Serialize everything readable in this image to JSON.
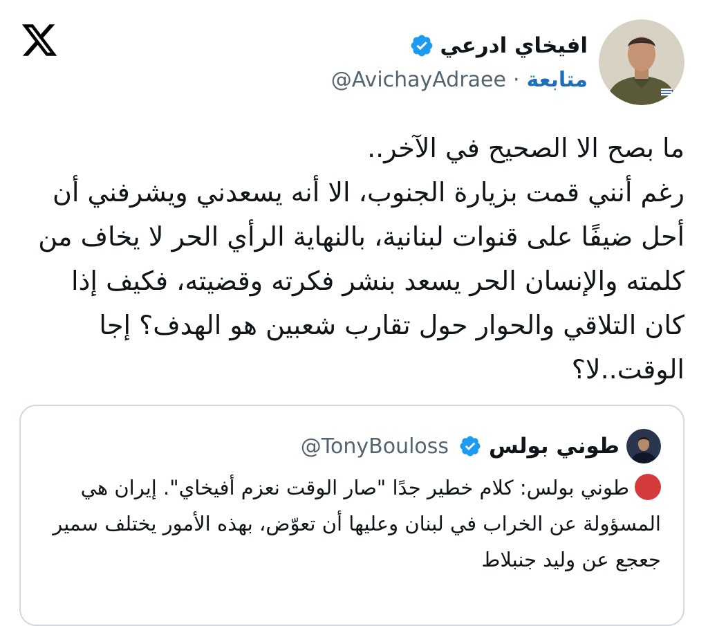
{
  "app": {
    "logo_icon": "x-logo-icon"
  },
  "tweet": {
    "author": {
      "display_name": "افيخاي ادرعي",
      "handle": "@AvichayAdraee",
      "verified_icon": "verified-badge-icon",
      "follow_label": "متابعة",
      "separator": "·"
    },
    "text": "ما بصح الا الصحيح في الآخر..\nرغم أنني قمت بزيارة الجنوب، الا أنه يسعدني ويشرفني أن أحل ضيفًا على قنوات لبنانية، بالنهاية الرأي الحر لا يخاف من كلمته والإنسان الحر يسعد بنشر فكرته وقضيته، فكيف إذا كان التلاقي والحوار حول تقارب شعبين هو الهدف؟ إجا الوقت..لا؟"
  },
  "quote": {
    "author": {
      "display_name": "طوني بولس",
      "handle": "@TonyBouloss",
      "verified_icon": "verified-badge-icon"
    },
    "indicator_icon": "red-circle-icon",
    "text": "طوني بولس: كلام خطير جدًا \"صار الوقت نعزم أفيخاي\". إيران هي المسؤولة عن الخراب في لبنان وعليها أن تعوّض، بهذه الأمور يختلف سمير جعجع عن وليد جنبلاط"
  },
  "colors": {
    "text": "#0f1419",
    "secondary": "#536471",
    "link": "#1d6fb8",
    "verified": "#1d9bf0",
    "border": "#cfd9de",
    "red_indicator": "#d53b3b"
  }
}
